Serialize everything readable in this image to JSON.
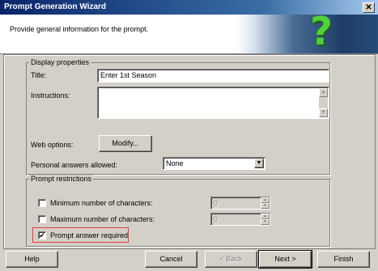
{
  "window": {
    "title": "Prompt Generation Wizard",
    "close_glyph": "✕"
  },
  "header": {
    "text": "Provide general information for the prompt.",
    "art_glyph": "?"
  },
  "display": {
    "legend": "Display properties",
    "title_label": "Title:",
    "title_value": "Enter 1st Season",
    "instructions_label": "Instructions:",
    "instructions_value": "",
    "web_options_label": "Web options:",
    "modify_label": "Modify...",
    "personal_label": "Personal answers allowed:",
    "personal_value": "None"
  },
  "restrictions": {
    "legend": "Prompt restrictions",
    "min_label": "Minimum number of characters:",
    "min_value": "0",
    "min_checked": false,
    "max_label": "Maximum number of characters:",
    "max_value": "0",
    "max_checked": false,
    "required_label": "Prompt answer required",
    "required_checked": true
  },
  "footer": {
    "help": "Help",
    "cancel": "Cancel",
    "back": "< Back",
    "next": "Next >",
    "finish": "Finish"
  },
  "colors": {
    "title_bar": "#0a246a",
    "accent_red": "#e23b3b",
    "dialog_bg": "#d4d0c8"
  }
}
